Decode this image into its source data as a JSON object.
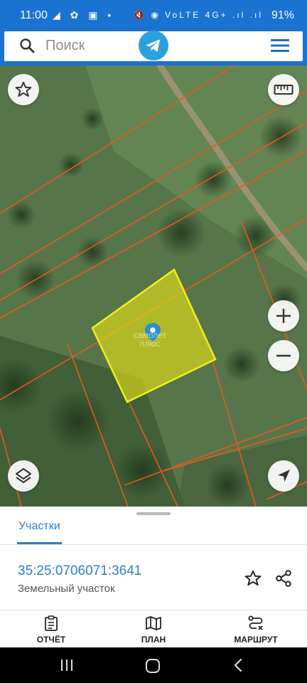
{
  "status_bar": {
    "time": "11:00",
    "left_icons": "◢ ✿ ▣ •",
    "right_icons": "🔇 ◉ VoLTE 4G+ .ıl .ıl",
    "battery": "91%"
  },
  "search": {
    "placeholder": "Поиск",
    "icons": [
      "search-icon",
      "telegram-icon",
      "menu-icon"
    ]
  },
  "map": {
    "watermark_line1": "самолет",
    "watermark_line2": "плюс",
    "controls": [
      "favorite-icon",
      "ruler-icon",
      "zoom-in-icon",
      "zoom-out-icon",
      "layers-icon",
      "locate-icon"
    ],
    "colors": {
      "selected_parcel_fill": "#e8e414",
      "selected_parcel_border": "#f2ef1a",
      "boundary_lines": "#e8581f",
      "marker": "#2a8fcf"
    }
  },
  "sheet": {
    "tab_label": "Участки",
    "parcel_number": "35:25:0706071:3641",
    "parcel_type": "Земельный участок",
    "accent_color": "#2f7fc1"
  },
  "actions": [
    {
      "label": "ОТЧЁТ",
      "icon": "report-icon"
    },
    {
      "label": "ПЛАН",
      "icon": "map-icon"
    },
    {
      "label": "МАРШРУТ",
      "icon": "route-icon"
    }
  ],
  "nav": [
    "recents-icon",
    "home-icon",
    "back-icon"
  ]
}
